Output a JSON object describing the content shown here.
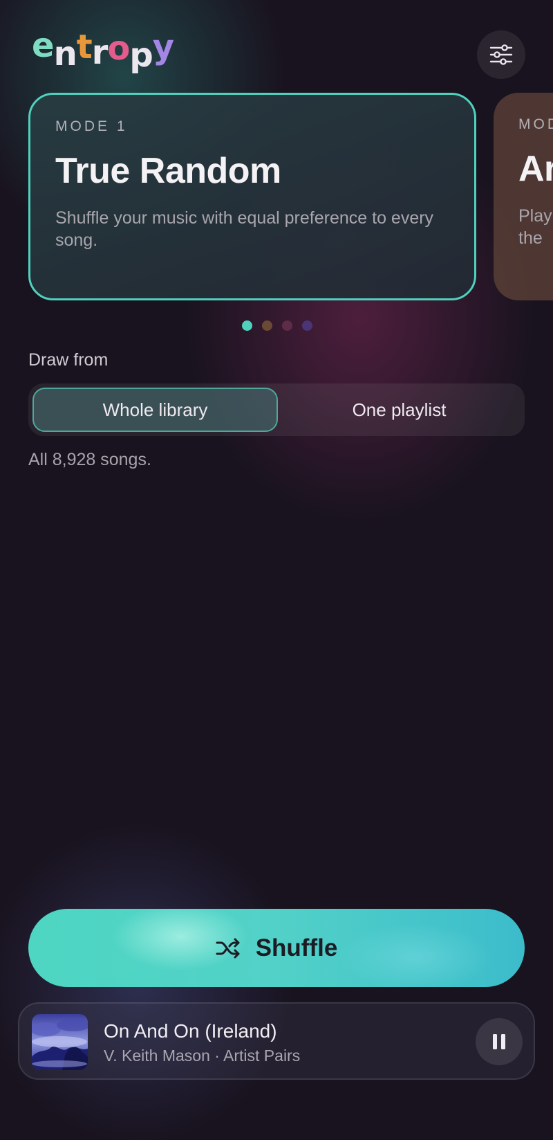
{
  "app": {
    "logo_letters": [
      "e",
      "n",
      "t",
      "r",
      "o",
      "p",
      "y"
    ]
  },
  "header": {
    "settings_icon": "sliders-icon"
  },
  "modes": [
    {
      "mode_label": "MODE 1",
      "title": "True Random",
      "description": "Shuffle your music with equal preference to every song.",
      "accent": "#4fd1bd"
    },
    {
      "mode_label": "MOD",
      "title": "Ar",
      "description": "Play\nthe",
      "accent": "#8a5a3a"
    }
  ],
  "pagination": {
    "active_index": 0,
    "dot_colors": [
      "#4fd1bd",
      "#6b4a35",
      "#5e2c47",
      "#4b3577"
    ]
  },
  "draw_from": {
    "label": "Draw from",
    "options": [
      "Whole library",
      "One playlist"
    ],
    "selected": "Whole library",
    "summary": "All 8,928 songs."
  },
  "shuffle_button": {
    "label": "Shuffle",
    "icon": "shuffle-icon"
  },
  "now_playing": {
    "title": "On And On (Ireland)",
    "subtitle": "V. Keith Mason · Artist Pairs",
    "control_icon": "pause-icon"
  }
}
